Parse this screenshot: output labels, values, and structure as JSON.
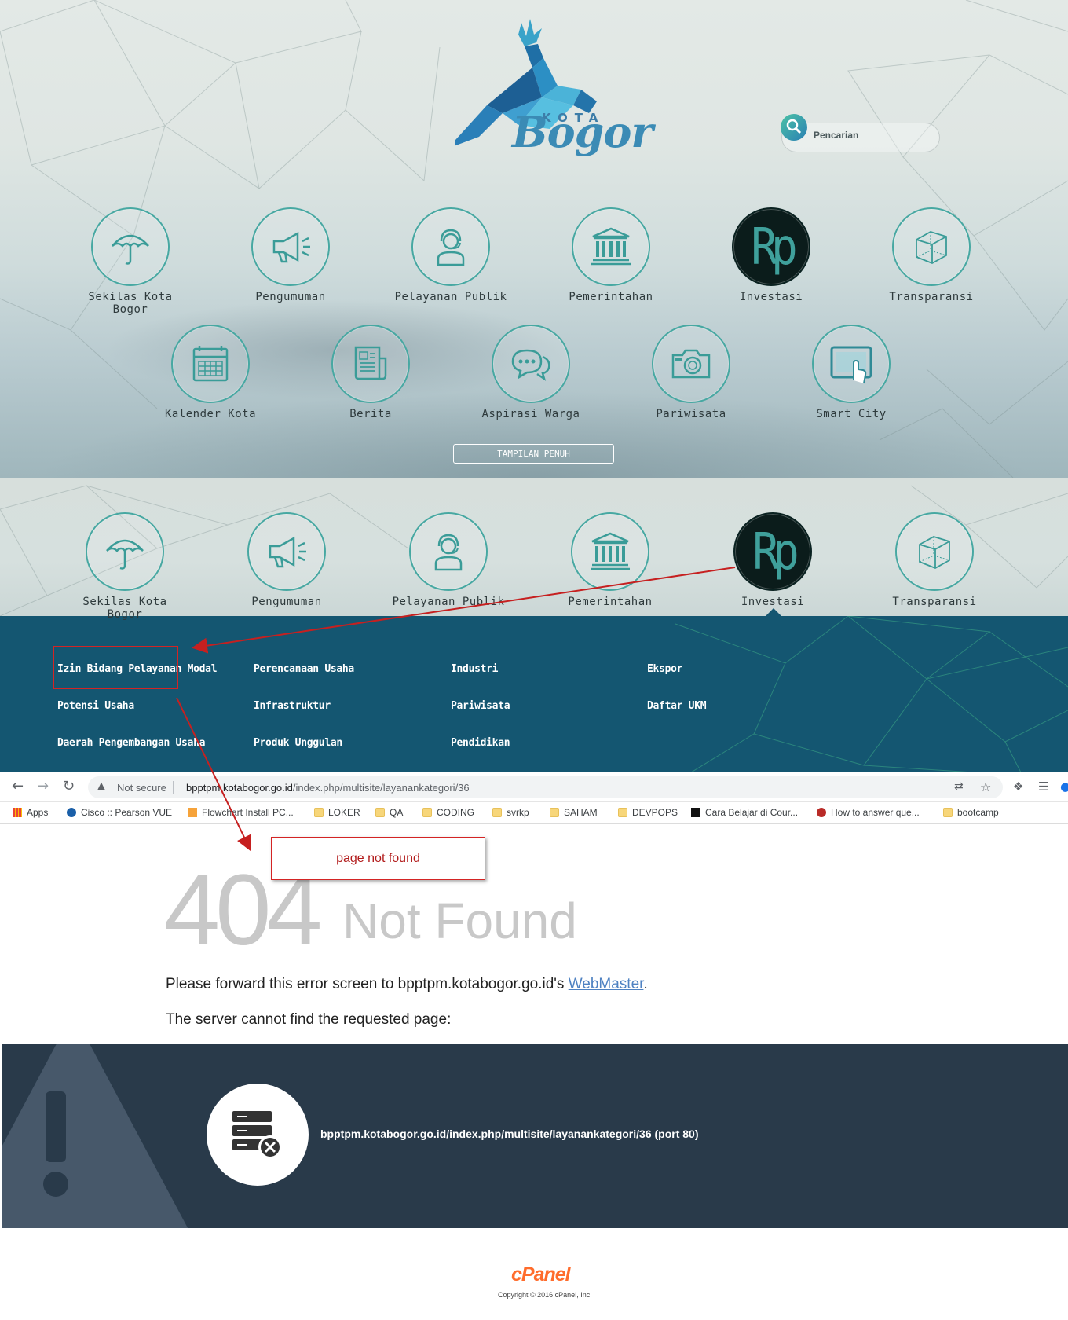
{
  "portal": {
    "logo": {
      "kota": "KOTA",
      "bogor": "Bogor"
    },
    "search": {
      "placeholder": "Pencarian"
    },
    "menu": [
      {
        "label": "Sekilas Kota Bogor",
        "icon": "umbrella-icon"
      },
      {
        "label": "Pengumuman",
        "icon": "megaphone-icon"
      },
      {
        "label": "Pelayanan Publik",
        "icon": "headset-agent-icon"
      },
      {
        "label": "Pemerintahan",
        "icon": "government-building-icon"
      },
      {
        "label": "Investasi",
        "icon": "rupiah-icon",
        "icon_text": "Rp"
      },
      {
        "label": "Transparansi",
        "icon": "cube-icon"
      },
      {
        "label": "Kalender Kota",
        "icon": "calendar-icon"
      },
      {
        "label": "Berita",
        "icon": "newspaper-icon"
      },
      {
        "label": "Aspirasi Warga",
        "icon": "chat-bubbles-icon"
      },
      {
        "label": "Pariwisata",
        "icon": "camera-icon"
      },
      {
        "label": "Smart City",
        "icon": "touch-tablet-icon"
      }
    ],
    "full_view_button": "TAMPILAN PENUH"
  },
  "submenu": {
    "links": [
      "Izin Bidang Pelayanan Modal",
      "Perencanaan Usaha",
      "Industri",
      "Ekspor",
      "Potensi Usaha",
      "Infrastruktur",
      "Pariwisata",
      "Daftar UKM",
      "Daerah Pengembangan Usaha",
      "Produk Unggulan",
      "Pendidikan"
    ]
  },
  "browser": {
    "security": "Not secure",
    "url_host": "bpptpm.kotabogor.go.id",
    "url_path": "/index.php/multisite/layanankategori/36",
    "bookmarks": [
      {
        "label": "Apps",
        "icon": "apps-grid-icon"
      },
      {
        "label": "Cisco :: Pearson VUE",
        "icon": "pearson-icon"
      },
      {
        "label": "Flowchart Install PC...",
        "icon": "flowchart-icon"
      },
      {
        "label": "LOKER",
        "icon": "folder-icon"
      },
      {
        "label": "QA",
        "icon": "folder-icon"
      },
      {
        "label": "CODING",
        "icon": "folder-icon"
      },
      {
        "label": "svrkp",
        "icon": "folder-icon"
      },
      {
        "label": "SAHAM",
        "icon": "folder-icon"
      },
      {
        "label": "DEVPOPS",
        "icon": "folder-icon"
      },
      {
        "label": "Cara Belajar di Cour...",
        "icon": "medium-icon"
      },
      {
        "label": "How to answer que...",
        "icon": "quora-icon"
      },
      {
        "label": "bootcamp",
        "icon": "folder-icon"
      }
    ]
  },
  "annotation": {
    "note": "page not found",
    "arrow_color": "#c62020"
  },
  "error_page": {
    "code": "404",
    "title": "Not Found",
    "message_prefix": "Please forward this error screen to bpptpm.kotabogor.go.id's ",
    "message_link": "WebMaster",
    "message_suffix": ".",
    "message2": "The server cannot find the requested page:",
    "requested": "bpptpm.kotabogor.go.id/index.php/multisite/layanankategori/36 (port 80)",
    "footer_brand": "cPanel",
    "footer_copyright": "Copyright © 2016 cPanel, Inc."
  },
  "colors": {
    "teal_accent": "#47a8a2",
    "submenu_bg": "#145671",
    "error_panel_bg": "#293a4a",
    "cpanel_orange": "#ff6c2c",
    "link_blue": "#4f82c2"
  }
}
